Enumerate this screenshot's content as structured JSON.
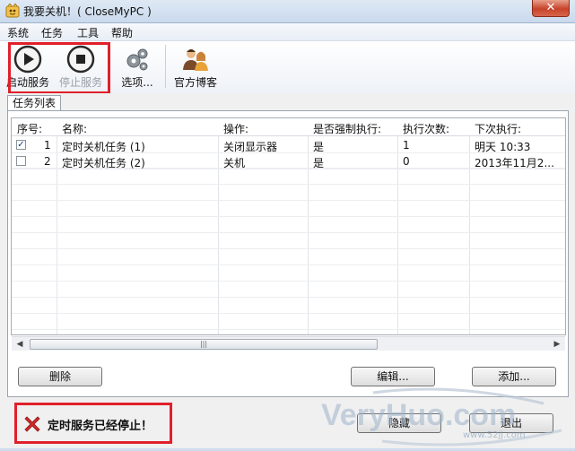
{
  "window": {
    "title": "我要关机！( CloseMyPC )",
    "close_glyph": "✕"
  },
  "menu": [
    "系统",
    "任务",
    "工具",
    "帮助"
  ],
  "toolbar": {
    "start_label": "启动服务",
    "stop_label": "停止服务",
    "options_label": "选项...",
    "blog_label": "官方博客"
  },
  "tab_label": "任务列表",
  "table": {
    "headers": [
      "序号:",
      "名称:",
      "操作:",
      "是否强制执行:",
      "执行次数:",
      "下次执行:"
    ],
    "rows": [
      {
        "checked": true,
        "index": "1",
        "name": "定时关机任务 (1)",
        "action": "关闭显示器",
        "force": "是",
        "count": "1",
        "next": "明天 10:33"
      },
      {
        "checked": false,
        "index": "2",
        "name": "定时关机任务 (2)",
        "action": "关机",
        "force": "是",
        "count": "0",
        "next": "2013年11月2..."
      }
    ]
  },
  "buttons": {
    "delete": "删除",
    "edit": "编辑...",
    "add": "添加...",
    "hide": "隐藏",
    "exit": "退出"
  },
  "status_message": "定时服务已经停止！",
  "watermark": {
    "text": "VeryHuo.com",
    "sub": "www.52jj.com"
  },
  "colors": {
    "highlight_box": "#e0202a",
    "status_icon": "#d42a2a"
  },
  "icons": {
    "app": "app-icon",
    "start": "play-icon",
    "stop": "stop-icon",
    "options": "gears-icon",
    "blog": "users-icon",
    "status": "error-x-icon"
  }
}
